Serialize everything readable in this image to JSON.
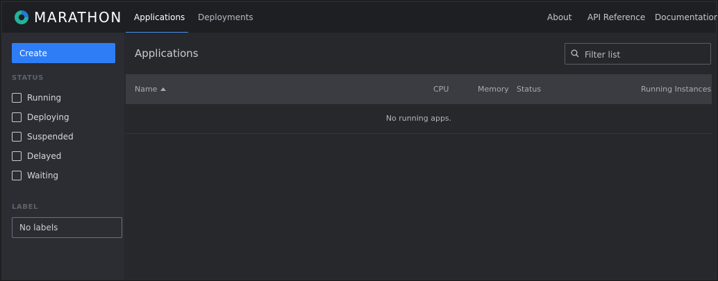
{
  "app": {
    "name": "MARATHON"
  },
  "nav": {
    "tabs": [
      {
        "label": "Applications",
        "active": true
      },
      {
        "label": "Deployments",
        "active": false
      }
    ],
    "links": [
      "About",
      "API Reference",
      "Documentation"
    ]
  },
  "sidebar": {
    "create_label": "Create",
    "status_title": "STATUS",
    "status_filters": [
      "Running",
      "Deploying",
      "Suspended",
      "Delayed",
      "Waiting"
    ],
    "label_title": "LABEL",
    "label_select": "No labels"
  },
  "main": {
    "title": "Applications",
    "filter_placeholder": "Filter list",
    "filter_value": "",
    "columns": [
      "Name",
      "CPU",
      "Memory",
      "Status",
      "Running Instances"
    ],
    "sort_column": "Name",
    "empty_message": "No running apps."
  },
  "colors": {
    "accent": "#2f7df6",
    "tab_underline": "#4b8df0",
    "background": "#27292d",
    "topbar": "#1d1f23"
  },
  "icons": [
    "marathon-logo-icon",
    "search-icon",
    "sort-asc-icon",
    "checkbox-icon"
  ]
}
